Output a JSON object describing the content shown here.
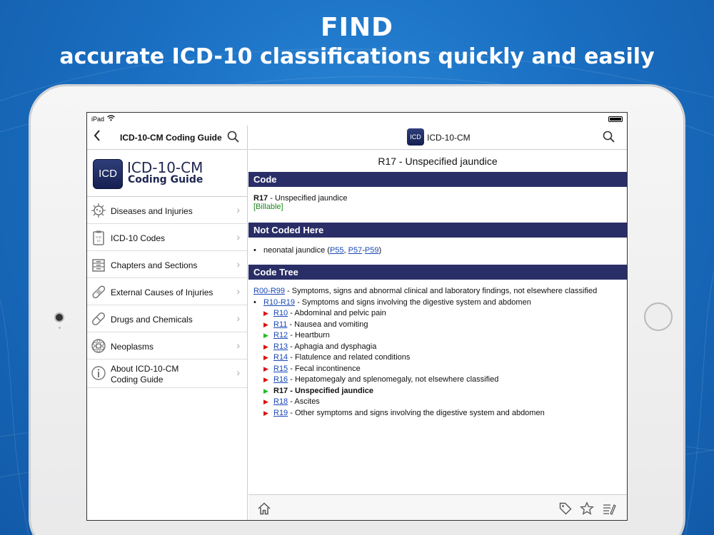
{
  "headline": {
    "line1": "FIND",
    "line2": "accurate ICD-10 classifications quickly and easily"
  },
  "statusbar": {
    "carrier": "iPad"
  },
  "left": {
    "title": "ICD-10-CM Coding Guide",
    "logo": {
      "badge": "ICD",
      "line1": "ICD-10-CM",
      "line2": "Coding Guide"
    },
    "menu": [
      {
        "label": "Diseases and Injuries",
        "icon": "virus-icon"
      },
      {
        "label": "ICD-10 Codes",
        "icon": "clipboard-icon"
      },
      {
        "label": "Chapters and Sections",
        "icon": "filebox-icon"
      },
      {
        "label": "External Causes of Injuries",
        "icon": "bandage-icon"
      },
      {
        "label": "Drugs and Chemicals",
        "icon": "pill-icon"
      },
      {
        "label": "Neoplasms",
        "icon": "cell-icon"
      }
    ],
    "about": {
      "line1": "About ICD-10-CM",
      "line2": "Coding Guide"
    }
  },
  "right": {
    "title": "ICD-10-CM",
    "badge": "ICD",
    "heading": "R17 - Unspecified jaundice",
    "sections": {
      "code": "Code",
      "not_coded": "Not Coded Here",
      "tree": "Code Tree"
    },
    "code_block": {
      "code": "R17",
      "desc": " - Unspecified jaundice",
      "billable": "[Billable]"
    },
    "not_coded": {
      "text": "neonatal jaundice (",
      "l1": "P55",
      "sep1": ", ",
      "l2": "P57",
      "dash": "-",
      "l3": "P59",
      "close": ")"
    },
    "tree_root": {
      "link": "R00-R99",
      "desc": " - Symptoms, signs and abnormal clinical and laboratory findings, not elsewhere classified"
    },
    "tree_sub": {
      "link": "R10-R19",
      "desc": " - Symptoms and signs involving the digestive system and abdomen"
    },
    "tree_items": [
      {
        "code": "R10",
        "desc": " - Abdominal and pelvic pain",
        "color": "red"
      },
      {
        "code": "R11",
        "desc": " - Nausea and vomiting",
        "color": "red"
      },
      {
        "code": "R12",
        "desc": " - Heartburn",
        "color": "green"
      },
      {
        "code": "R13",
        "desc": " - Aphagia and dysphagia",
        "color": "red"
      },
      {
        "code": "R14",
        "desc": " - Flatulence and related conditions",
        "color": "red"
      },
      {
        "code": "R15",
        "desc": " - Fecal incontinence",
        "color": "red"
      },
      {
        "code": "R16",
        "desc": " - Hepatomegaly and splenomegaly, not elsewhere classified",
        "color": "red"
      },
      {
        "code": "R17",
        "desc": " - Unspecified jaundice",
        "color": "green",
        "current": true
      },
      {
        "code": "R18",
        "desc": " - Ascites",
        "color": "red"
      },
      {
        "code": "R19",
        "desc": " - Other symptoms and signs involving the digestive system and abdomen",
        "color": "red"
      }
    ]
  },
  "colors": {
    "header_bg": "#2a2e66",
    "billable": "#1a8a1a",
    "link": "#1848b8",
    "tri_red": "#dd1111",
    "tri_green": "#22bb22",
    "background": "#1a6fc2"
  }
}
